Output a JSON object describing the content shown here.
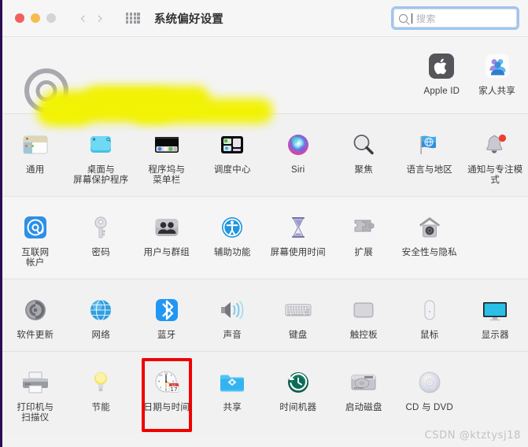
{
  "window": {
    "title": "系统偏好设置",
    "traffic_lights": [
      "close-red",
      "minimize-yellow",
      "zoom-gray-disabled"
    ],
    "nav": {
      "back": "‹",
      "forward": "›"
    },
    "grid_button": "show-all-grid-icon"
  },
  "search": {
    "placeholder": "搜索",
    "value": "",
    "focused": true,
    "focus_ring_color": "#9ec6f0"
  },
  "profile": {
    "name_redacted": true,
    "redaction_color": "#f2f205",
    "avatar": "user-avatar-placeholder",
    "apps": [
      {
        "label": "Apple ID",
        "icon": "apple-id-icon"
      },
      {
        "label": "家人共享",
        "icon": "family-sharing-icon"
      }
    ]
  },
  "sections": [
    {
      "name": "preferences-row-1",
      "items": [
        {
          "label": "通用",
          "icon": "general-icon"
        },
        {
          "label": "桌面与\n屏幕保护程序",
          "icon": "desktop-screensaver-icon"
        },
        {
          "label": "程序坞与\n菜单栏",
          "icon": "dock-menubar-icon"
        },
        {
          "label": "调度中心",
          "icon": "mission-control-icon"
        },
        {
          "label": "Siri",
          "icon": "siri-icon"
        },
        {
          "label": "聚焦",
          "icon": "spotlight-icon"
        },
        {
          "label": "语言与地区",
          "icon": "language-region-icon"
        },
        {
          "label": "通知与专注模式",
          "icon": "notifications-focus-icon"
        }
      ]
    },
    {
      "name": "preferences-row-2",
      "items": [
        {
          "label": "互联网\n帐户",
          "icon": "internet-accounts-icon"
        },
        {
          "label": "密码",
          "icon": "passwords-key-icon"
        },
        {
          "label": "用户与群组",
          "icon": "users-groups-icon"
        },
        {
          "label": "辅助功能",
          "icon": "accessibility-icon"
        },
        {
          "label": "屏幕使用时间",
          "icon": "screen-time-hourglass-icon"
        },
        {
          "label": "扩展",
          "icon": "extensions-puzzle-icon"
        },
        {
          "label": "安全性与隐私",
          "icon": "security-privacy-house-icon"
        }
      ]
    },
    {
      "name": "preferences-row-3",
      "items": [
        {
          "label": "软件更新",
          "icon": "software-update-icon"
        },
        {
          "label": "网络",
          "icon": "network-globe-icon"
        },
        {
          "label": "蓝牙",
          "icon": "bluetooth-icon"
        },
        {
          "label": "声音",
          "icon": "sound-speaker-icon"
        },
        {
          "label": "键盘",
          "icon": "keyboard-icon"
        },
        {
          "label": "触控板",
          "icon": "trackpad-icon"
        },
        {
          "label": "鼠标",
          "icon": "mouse-icon"
        },
        {
          "label": "显示器",
          "icon": "displays-icon"
        }
      ]
    },
    {
      "name": "preferences-row-4",
      "items": [
        {
          "label": "打印机与\n扫描仪",
          "icon": "printers-scanners-icon"
        },
        {
          "label": "节能",
          "icon": "energy-saver-bulb-icon"
        },
        {
          "label": "日期与时间",
          "icon": "date-time-clock-icon",
          "highlighted": true,
          "highlight_color": "#f00000",
          "badge_month": "JUL",
          "badge_day": "17"
        },
        {
          "label": "共享",
          "icon": "sharing-folder-icon"
        },
        {
          "label": "时间机器",
          "icon": "time-machine-icon"
        },
        {
          "label": "启动磁盘",
          "icon": "startup-disk-icon"
        },
        {
          "label": "CD 与 DVD",
          "icon": "cd-dvd-icon"
        }
      ]
    }
  ],
  "watermark": "CSDN @ktztysj18"
}
